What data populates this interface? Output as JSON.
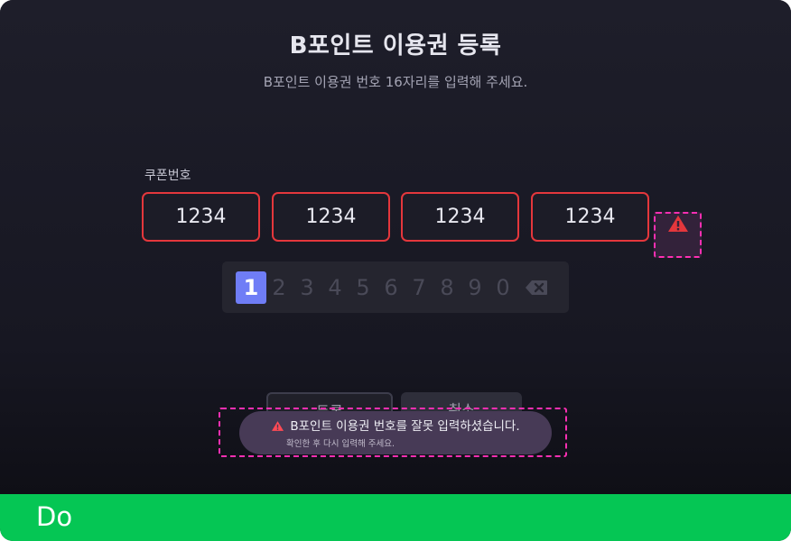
{
  "screen": {
    "title": "B포인트 이용권 등록",
    "subtitle": "B포인트 이용권 번호 16자리를 입력해 주세요.",
    "field_label": "쿠폰번호",
    "code_groups": [
      "1234",
      "1234",
      "1234",
      "1234"
    ],
    "input_state": "error"
  },
  "keypad": {
    "keys": [
      "1",
      "2",
      "3",
      "4",
      "5",
      "6",
      "7",
      "8",
      "9",
      "0"
    ],
    "selected": "1",
    "backspace_icon": "backspace-icon"
  },
  "buttons": {
    "confirm_label": "등록",
    "cancel_label": "취소"
  },
  "toast": {
    "icon": "warning-icon",
    "message": "B포인트 이용권 번호를 잘못 입력하셨습니다.",
    "detail": "확인한 후 다시 입력해 주세요."
  },
  "footer": {
    "label": "Do"
  },
  "colors": {
    "error": "#e4373c",
    "accent": "#6f7df6",
    "highlight_marker": "#ff2fb3",
    "do_bar": "#05c654"
  }
}
